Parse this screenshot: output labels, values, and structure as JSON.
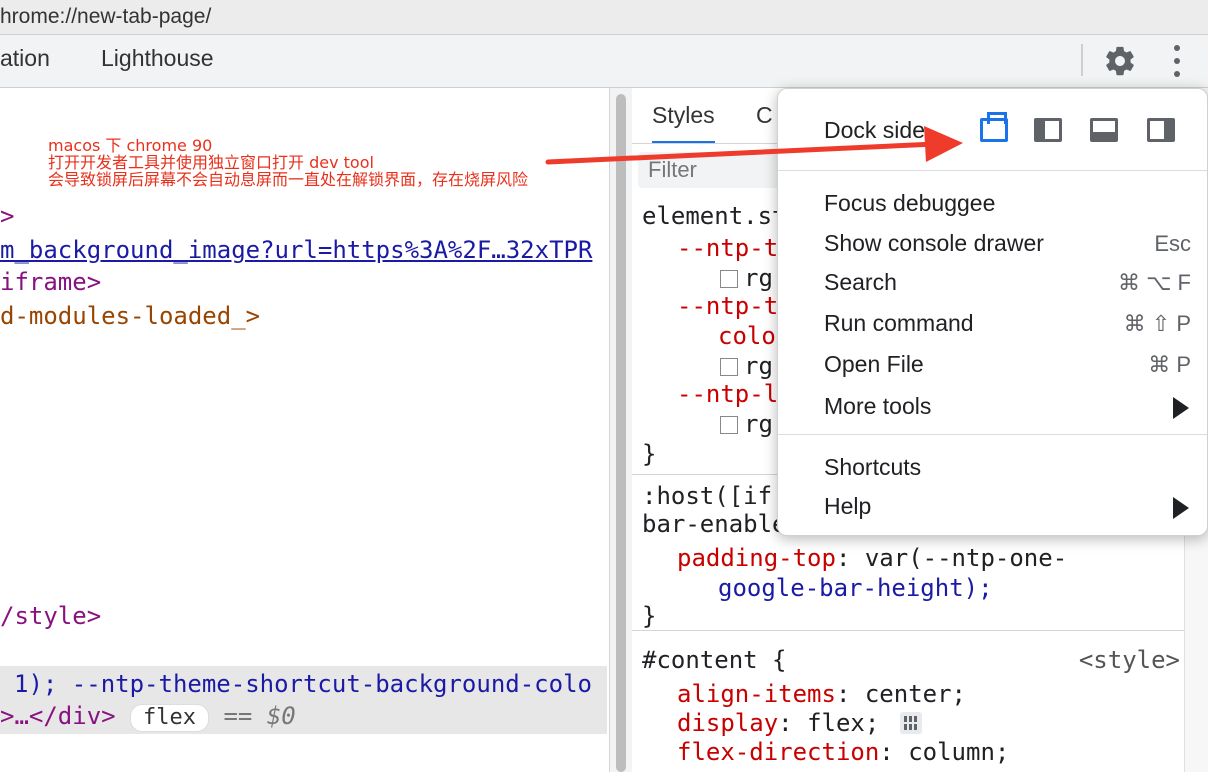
{
  "url_bar": {
    "text": "hrome://new-tab-page/"
  },
  "devtools_tabs": [
    {
      "label": "ation"
    },
    {
      "label": "Lighthouse"
    }
  ],
  "annotation": {
    "lines": [
      "macos 下 chrome 90",
      "打开开发者工具并使用独立窗口打开 dev tool",
      "会导致锁屏后屏幕不会自动息屏而一直处在解锁界面，存在烧屏风险"
    ],
    "color": "#e8301c"
  },
  "elements": {
    "line1": ">",
    "line2_link": "m_background_image?url=https%3A%2F…32xTPR",
    "line3": "iframe>",
    "line4": "d-modules-loaded_>",
    "line5": "/style>",
    "selected_line1": "1); --ntp-theme-shortcut-background-colo",
    "selected_line2_pre": ">…</div>",
    "selected_pill": "flex",
    "selected_eq": "== $0"
  },
  "styles_pane": {
    "tabs": [
      {
        "label": "Styles"
      },
      {
        "label": "C"
      }
    ],
    "filter_placeholder": "Filter",
    "block1": {
      "selector": "element.st",
      "p1": "--ntp-t",
      "v1": "rg",
      "p2": "--ntp-t",
      "p2b": "colo",
      "v2": "rg",
      "p3": "--ntp-l",
      "v3": "rg",
      "close": "}"
    },
    "block2": {
      "selector1": ":host([if",
      "selector2": "bar-enable",
      "prop": "padding-top",
      "val1": "var(--ntp-one-",
      "val2": "google-bar-height);",
      "close": "}"
    },
    "block3": {
      "selector": "#content {",
      "source": "<style>",
      "p1": "align-items",
      "v1": "center;",
      "p2": "display",
      "v2": "flex;",
      "p3": "flex-direction",
      "v3": "column;"
    }
  },
  "menu": {
    "dock_side_label": "Dock side",
    "dock_icons": [
      "undock-icon",
      "dock-left-icon",
      "dock-bottom-icon",
      "dock-right-icon"
    ],
    "items": [
      {
        "label": "Focus debuggee",
        "shortcut": ""
      },
      {
        "label": "Show console drawer",
        "shortcut": "Esc"
      },
      {
        "label": "Search",
        "shortcut": "⌘ ⌥ F"
      },
      {
        "label": "Run command",
        "shortcut": "⌘ ⇧ P"
      },
      {
        "label": "Open File",
        "shortcut": "⌘ P"
      },
      {
        "label": "More tools",
        "shortcut": ""
      }
    ],
    "items2": [
      {
        "label": "Shortcuts"
      },
      {
        "label": "Help"
      }
    ],
    "accent": "#1a73e8"
  }
}
